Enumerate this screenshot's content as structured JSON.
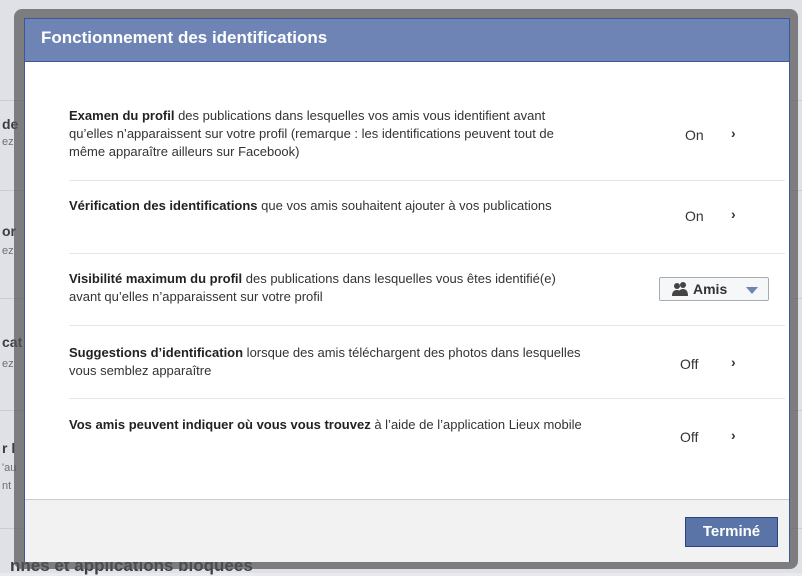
{
  "background": {
    "rows": [
      {
        "title": "de",
        "sub": "ez"
      },
      {
        "title": "or",
        "sub": "ez"
      },
      {
        "title": "cat",
        "sub": "ez"
      },
      {
        "title": "r l",
        "sub": "'au"
      },
      {
        "title": "",
        "sub": "nt"
      }
    ],
    "footer": "nnes et applications bloquées"
  },
  "dialog": {
    "title": "Fonctionnement des identifications",
    "settings": [
      {
        "bold": "Examen du profil",
        "text": " des publications dans lesquelles vos amis vous identifient avant qu’elles n’apparaissent sur votre profil (remarque : les identifications peuvent tout de même apparaître ailleurs sur Facebook)",
        "value": "On",
        "chevron": "›"
      },
      {
        "bold": "Vérification des identifications",
        "text": " que vos amis souhaitent ajouter à vos publications",
        "value": "On",
        "chevron": "›"
      },
      {
        "bold": "Visibilité maximum du profil",
        "text": " des publications dans lesquelles vous êtes identifié(e) avant qu’elles n’apparaissent sur votre profil",
        "audience": "Amis",
        "icon": "friends-icon"
      },
      {
        "bold": "Suggestions d’identification",
        "text": " lorsque des amis téléchargent des photos dans lesquelles vous semblez apparaître",
        "value": "Off",
        "chevron": "›"
      },
      {
        "bold": "Vos amis peuvent indiquer où vous vous trouvez",
        "text": " à l’aide de l’application Lieux mobile",
        "value": "Off",
        "chevron": "›"
      }
    ],
    "done_label": "Terminé"
  },
  "colors": {
    "header": "#6d84b4",
    "border": "#3b5998",
    "button": "#5b74a8"
  }
}
